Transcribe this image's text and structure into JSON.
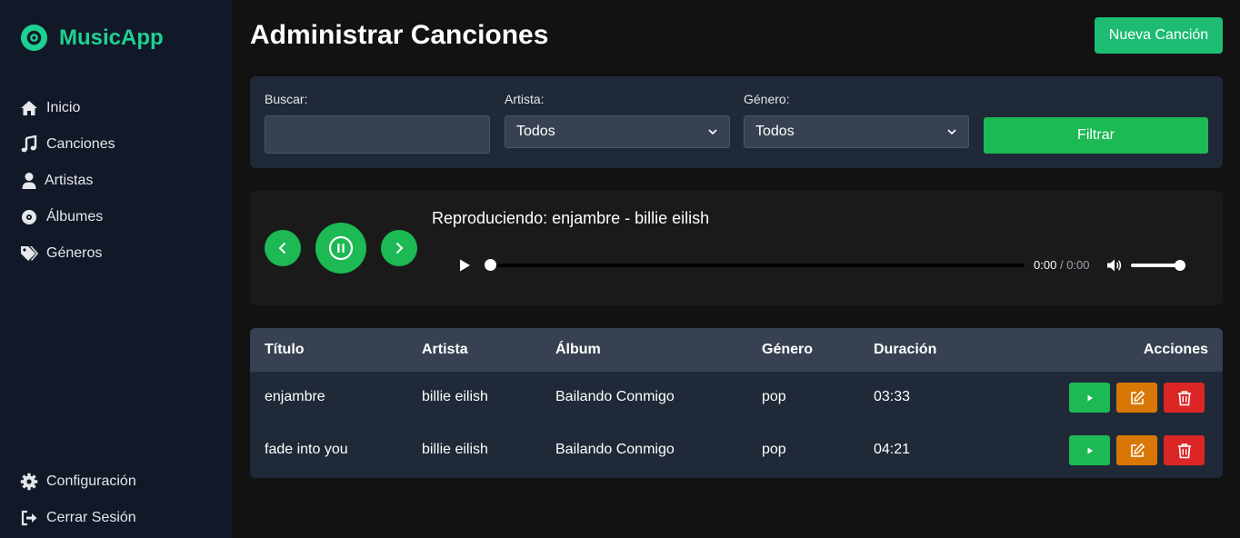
{
  "brand": {
    "name": "MusicApp",
    "color": "#1ed192"
  },
  "nav": {
    "items": [
      {
        "label": "Inicio",
        "icon": "home-icon"
      },
      {
        "label": "Canciones",
        "icon": "music-note-icon"
      },
      {
        "label": "Artistas",
        "icon": "user-icon"
      },
      {
        "label": "Álbumes",
        "icon": "compact-disc-icon"
      },
      {
        "label": "Géneros",
        "icon": "tags-icon"
      }
    ],
    "bottom": [
      {
        "label": "Configuración",
        "icon": "gear-icon"
      },
      {
        "label": "Cerrar Sesión",
        "icon": "sign-out-icon"
      }
    ]
  },
  "header": {
    "title": "Administrar Canciones",
    "new_button": "Nueva Canción"
  },
  "filters": {
    "search_label": "Buscar:",
    "search_value": "",
    "artist_label": "Artista:",
    "artist_selected": "Todos",
    "genre_label": "Género:",
    "genre_selected": "Todos",
    "filter_button": "Filtrar"
  },
  "player": {
    "now_playing": "Reproduciendo: enjambre - billie eilish",
    "current_time": "0:00",
    "separator": "/",
    "total_time": "0:00",
    "progress": 0,
    "volume": 1
  },
  "table": {
    "headers": {
      "title": "Título",
      "artist": "Artista",
      "album": "Álbum",
      "genre": "Género",
      "duration": "Duración",
      "actions": "Acciones"
    },
    "rows": [
      {
        "title": "enjambre",
        "artist": "billie eilish",
        "album": "Bailando Conmigo",
        "genre": "pop",
        "duration": "03:33"
      },
      {
        "title": "fade into you",
        "artist": "billie eilish",
        "album": "Bailando Conmigo",
        "genre": "pop",
        "duration": "04:21"
      }
    ]
  },
  "colors": {
    "accent": "#1db954",
    "edit": "#d97706",
    "delete": "#dc2626",
    "sidebar": "#111827",
    "card": "#1f2937"
  }
}
